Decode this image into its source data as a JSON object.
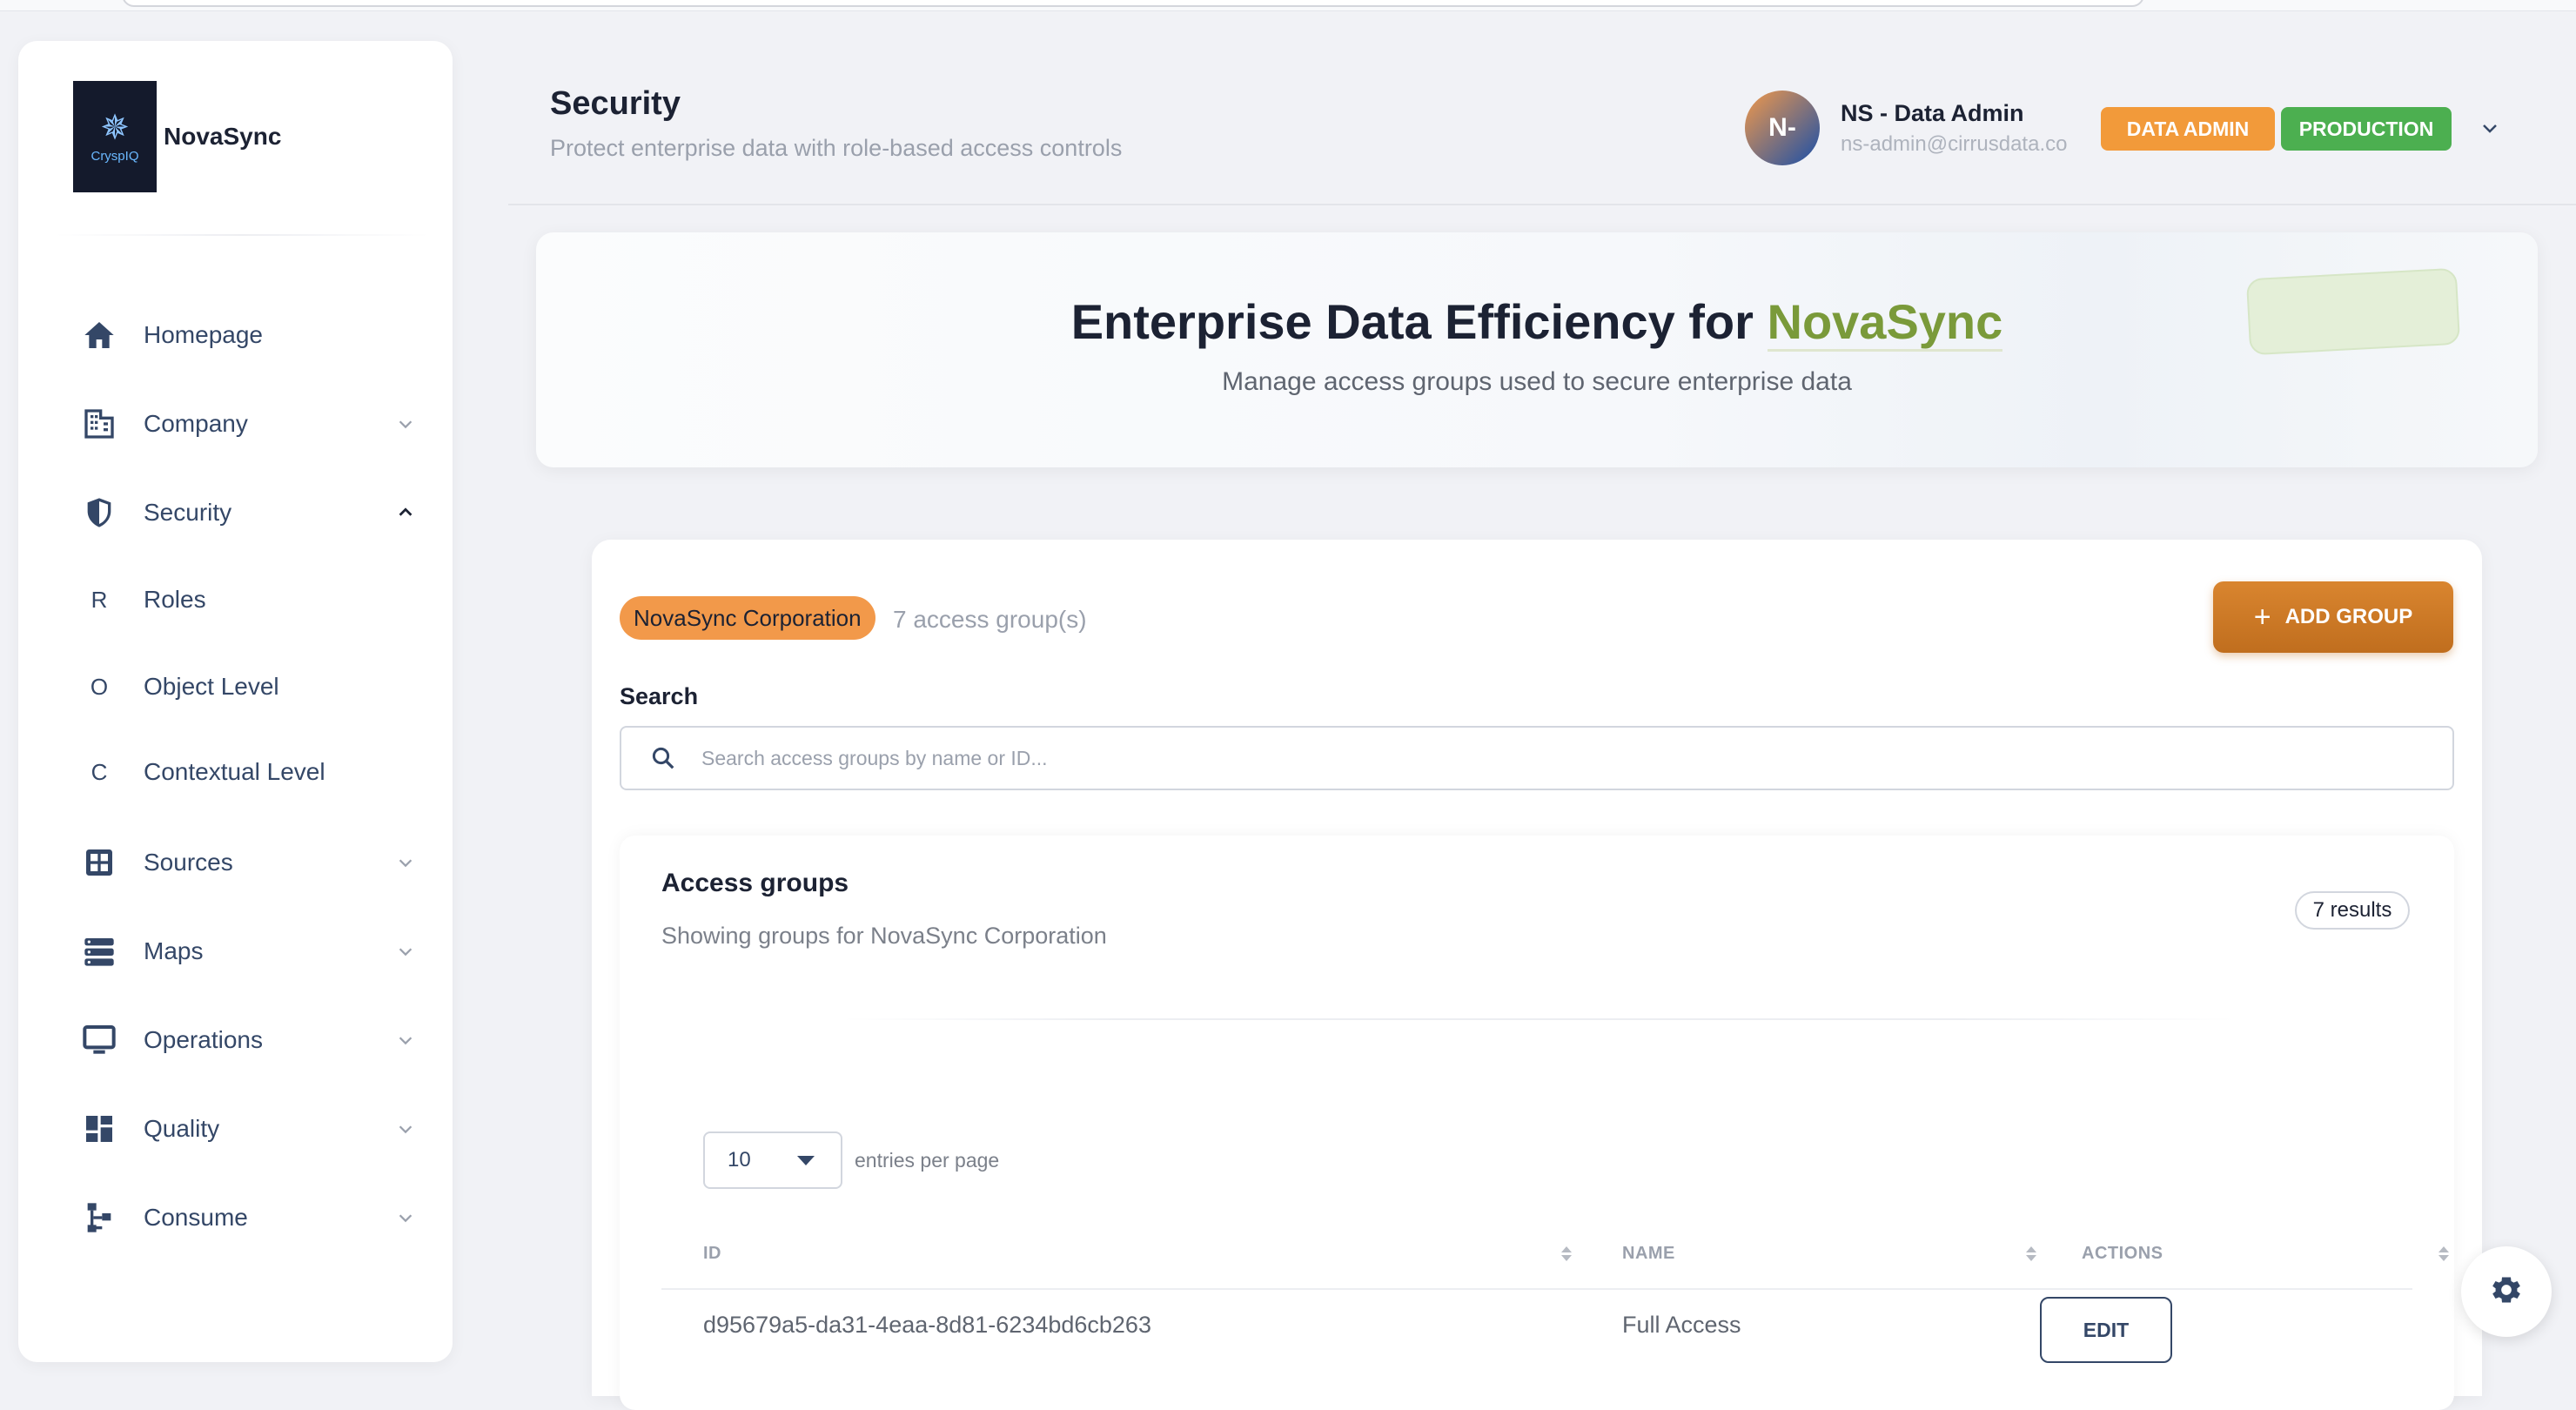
{
  "brand": {
    "name": "NovaSync",
    "logo_text": "CryspIQ"
  },
  "sidebar": {
    "items": [
      {
        "label": "Homepage",
        "icon": "home-icon",
        "chevron": "none"
      },
      {
        "label": "Company",
        "icon": "building-icon",
        "chevron": "down"
      },
      {
        "label": "Security",
        "icon": "shield-icon",
        "chevron": "up"
      },
      {
        "label": "Roles",
        "letter": "R",
        "chevron": "none"
      },
      {
        "label": "Object Level",
        "letter": "O",
        "chevron": "none"
      },
      {
        "label": "Contextual Level",
        "letter": "C",
        "chevron": "none"
      },
      {
        "label": "Sources",
        "icon": "grid-icon",
        "chevron": "down"
      },
      {
        "label": "Maps",
        "icon": "stack-icon",
        "chevron": "down"
      },
      {
        "label": "Operations",
        "icon": "monitor-icon",
        "chevron": "down"
      },
      {
        "label": "Quality",
        "icon": "dashboard-icon",
        "chevron": "down"
      },
      {
        "label": "Consume",
        "icon": "tree-icon",
        "chevron": "down"
      }
    ]
  },
  "header": {
    "title": "Security",
    "subtitle": "Protect enterprise data with role-based access controls"
  },
  "user": {
    "initials": "N-",
    "name": "NS - Data Admin",
    "email": "ns-admin@cirrusdata.co",
    "badges": [
      {
        "label": "DATA ADMIN",
        "color": "#f29a3a"
      },
      {
        "label": "PRODUCTION",
        "color": "#4caf50"
      }
    ]
  },
  "hero": {
    "title_prefix": "Enterprise Data Efficiency for ",
    "title_accent": "NovaSync",
    "subtitle": "Manage access groups used to secure enterprise data",
    "accent_color": "#7a9a3a"
  },
  "groups": {
    "org_chip": "NovaSync Corporation",
    "count_text": "7 access group(s)",
    "add_button": "ADD GROUP",
    "search_label": "Search",
    "search_placeholder": "Search access groups by name or ID...",
    "search_value": ""
  },
  "access_groups": {
    "title": "Access groups",
    "subtitle": "Showing groups for NovaSync Corporation",
    "results": "7 results",
    "page_size": "10",
    "entries_label": "entries per page",
    "columns": [
      "ID",
      "NAME",
      "ACTIONS"
    ],
    "rows": [
      {
        "id": "d95679a5-da31-4eaa-8d81-6234bd6cb263",
        "name": "Full Access",
        "action": "EDIT"
      }
    ]
  },
  "colors": {
    "primary": "#344767",
    "orange": "#f2994a",
    "green": "#4caf50",
    "button_orange": "#c87623"
  }
}
